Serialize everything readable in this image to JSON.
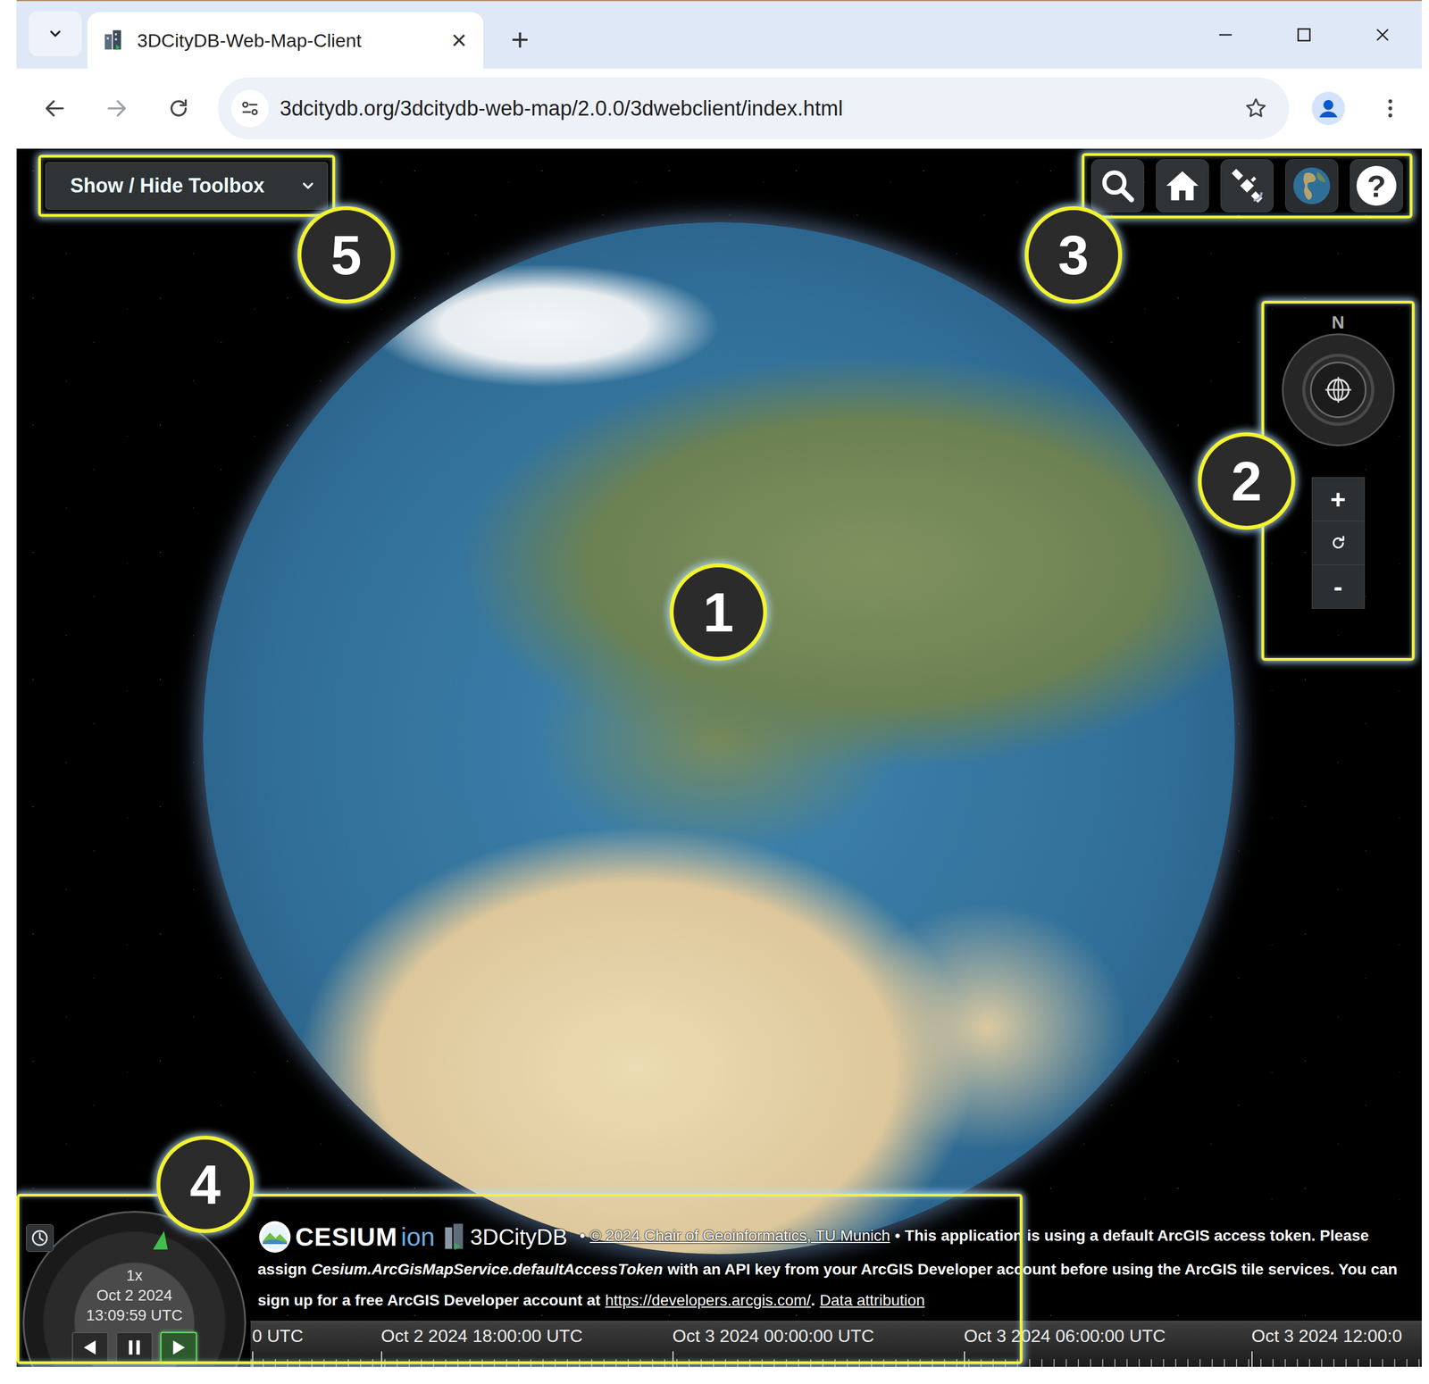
{
  "browser": {
    "tabs": [
      {
        "title": "3DCityDB-Web-Map-Client",
        "selected": true
      }
    ],
    "tab_close": "×",
    "new_tab": "+",
    "address": "3dcitydb.org/3dcitydb-web-map/2.0.0/3dwebclient/index.html"
  },
  "toolbox": {
    "label": "Show / Hide Toolbox"
  },
  "toolbar": {
    "help": "?"
  },
  "navigation": {
    "north": "N",
    "zoom_in": "+",
    "zoom_out": "-"
  },
  "clock": {
    "speed": "1x",
    "date": "Oct 2 2024",
    "time": "13:09:59 UTC",
    "buttons": [
      {
        "kind": "reverse",
        "selected": false
      },
      {
        "kind": "pause",
        "selected": false
      },
      {
        "kind": "play",
        "selected": true
      }
    ]
  },
  "credits": {
    "logos": {
      "cesium": "CESIUM",
      "ion": "ion",
      "citydb": "3DCityDB"
    },
    "segments": [
      {
        "text": "•",
        "kind": "plain"
      },
      {
        "text": "© 2024 Chair of Geoinformatics, TU Munich",
        "kind": "link"
      },
      {
        "text": "•",
        "kind": "plain"
      },
      {
        "text": "This application is using a default ArcGIS access token. Please assign",
        "kind": "plain"
      },
      {
        "text": "Cesium.ArcGisMapService.defaultAccessToken",
        "kind": "italic"
      },
      {
        "text": "with an API key from your ArcGIS Developer account before using the ArcGIS tile services. You can sign up for a free ArcGIS Developer account at",
        "kind": "plain"
      },
      {
        "text": "https://developers.arcgis.com/",
        "kind": "link"
      },
      {
        "text": ".",
        "kind": "punct"
      },
      {
        "text": "Data attribution",
        "kind": "link"
      }
    ]
  },
  "timeline": {
    "labels": [
      "0 UTC",
      "Oct 2 2024 18:00:00 UTC",
      "Oct 3 2024 00:00:00 UTC",
      "Oct 3 2024 06:00:00 UTC",
      "Oct 3 2024 12:00:0"
    ]
  },
  "callouts": [
    {
      "number": "1"
    },
    {
      "number": "2"
    },
    {
      "number": "3"
    },
    {
      "number": "4"
    },
    {
      "number": "5"
    }
  ]
}
